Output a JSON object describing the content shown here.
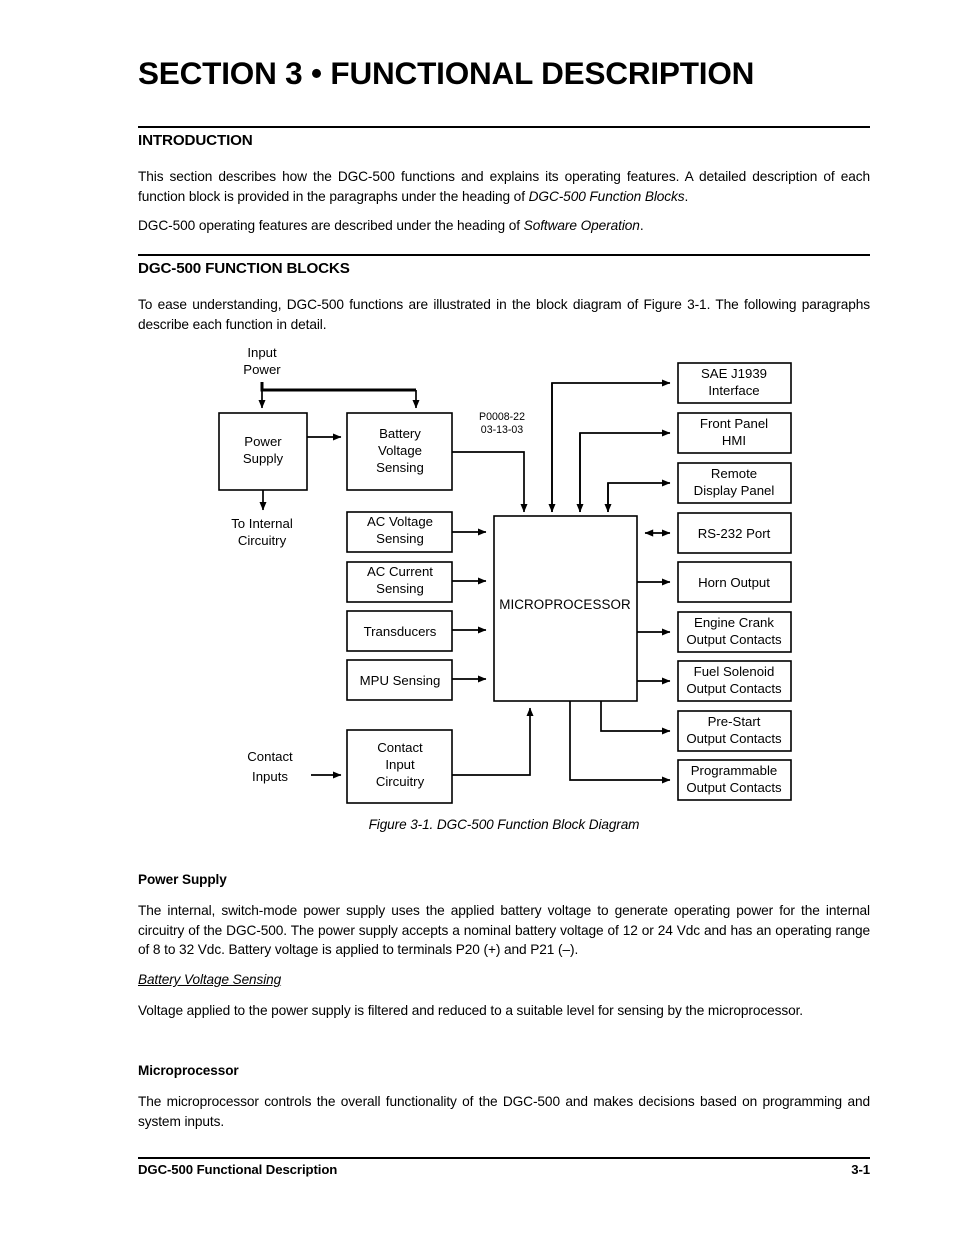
{
  "document": {
    "section_title": "SECTION 3 • FUNCTIONAL DESCRIPTION",
    "footer_left": "DGC-500 Functional Description",
    "footer_page": "3-1"
  },
  "introduction": {
    "heading": "INTRODUCTION",
    "para1_a": "This section describes how the DGC-500 functions and explains its operating features. A detailed description of each function block is provided in the paragraphs under the heading of ",
    "para1_em": "DGC-500 Function Blocks",
    "para1_b": ".",
    "para2_a": "DGC-500 operating features are described under the heading of ",
    "para2_em": "Software Operation",
    "para2_b": "."
  },
  "function_blocks": {
    "heading": "DGC-500 FUNCTION BLOCKS",
    "intro_para": "To ease understanding, DGC-500 functions are illustrated in the block diagram of Figure 3-1. The following paragraphs describe each function in detail."
  },
  "figure": {
    "caption": "Figure 3-1. DGC-500 Function Block Diagram",
    "drawing_number": "P0008-22",
    "drawing_date": "03-13-03",
    "labels": {
      "input_power_line1": "Input",
      "input_power_line2": "Power",
      "to_internal_line1": "To Internal",
      "to_internal_line2": "Circuitry",
      "contact_inputs_line1": "Contact",
      "contact_inputs_line2": "Inputs"
    },
    "blocks": {
      "power_supply_l1": "Power",
      "power_supply_l2": "Supply",
      "battery_l1": "Battery",
      "battery_l2": "Voltage",
      "battery_l3": "Sensing",
      "ac_voltage_l1": "AC Voltage",
      "ac_voltage_l2": "Sensing",
      "ac_current_l1": "AC Current",
      "ac_current_l2": "Sensing",
      "transducers_l1": "Transducers",
      "mpu_l1": "MPU Sensing",
      "contact_circ_l1": "Contact",
      "contact_circ_l2": "Input",
      "contact_circ_l3": "Circuitry",
      "microprocessor": "MICROPROCESSOR",
      "sae_l1": "SAE J1939",
      "sae_l2": "Interface",
      "front_panel_l1": "Front Panel",
      "front_panel_l2": "HMI",
      "remote_l1": "Remote",
      "remote_l2": "Display Panel",
      "rs232_l1": "RS-232 Port",
      "horn_l1": "Horn Output",
      "crank_l1": "Engine Crank",
      "crank_l2": "Output Contacts",
      "fuel_l1": "Fuel Solenoid",
      "fuel_l2": "Output Contacts",
      "prestart_l1": "Pre-Start",
      "prestart_l2": "Output Contacts",
      "prog_l1": "Programmable",
      "prog_l2": "Output Contacts"
    }
  },
  "power_supply_section": {
    "heading": "Power Supply",
    "body": "The internal, switch-mode power supply uses the applied battery voltage to generate operating power for the internal circuitry of the DGC-500. The power supply accepts a nominal battery voltage of 12 or 24 Vdc and has an operating range of 8 to 32 Vdc. Battery voltage is applied to terminals P20 (+) and P21 (–).",
    "sub_heading": "Battery Voltage Sensing",
    "sub_body": "Voltage applied to the power supply is filtered and reduced to a suitable level for sensing by the microprocessor."
  },
  "microprocessor_section": {
    "heading": "Microprocessor",
    "body": "The microprocessor controls the overall functionality of the DGC-500 and makes decisions based on programming and system inputs."
  }
}
